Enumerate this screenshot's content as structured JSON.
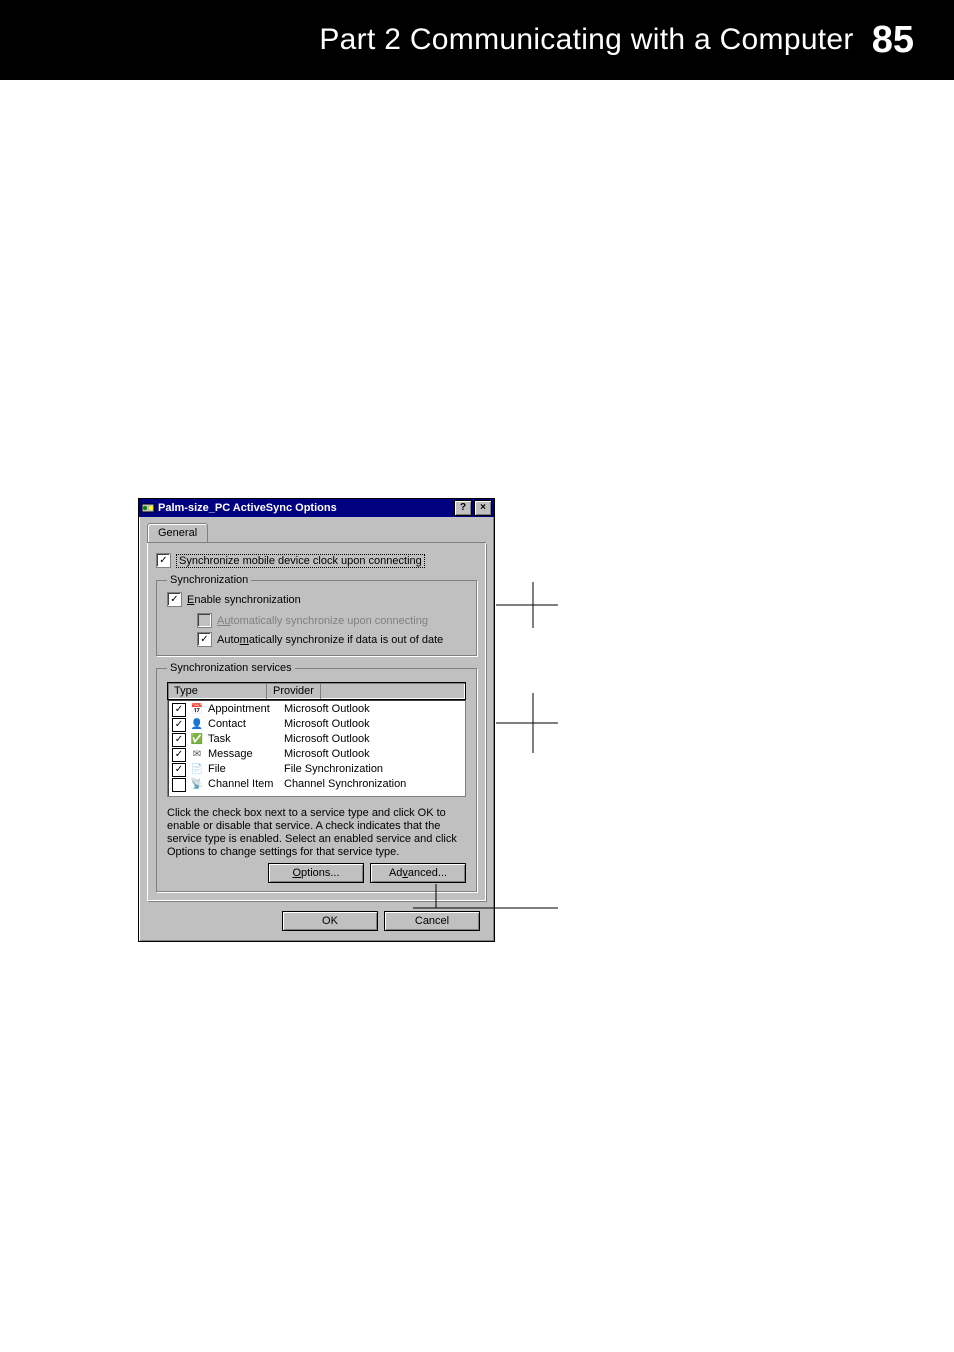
{
  "header": {
    "title": "Part 2  Communicating with a Computer",
    "page_number": "85"
  },
  "dialog": {
    "title": "Palm-size_PC ActiveSync Options",
    "titlebar": {
      "help": "?",
      "close": "×"
    },
    "tab": "General",
    "sync_clock_label": "Synchronize mobile device clock upon connecting",
    "group_sync": {
      "legend": "Synchronization",
      "enable_label_pre": "E",
      "enable_label_rest": "nable synchronization",
      "auto_connect_pre": "Au",
      "auto_connect_rest": "tomatically synchronize upon connecting",
      "auto_outofdate_pre": "Auto",
      "auto_outofdate_mid": "m",
      "auto_outofdate_rest": "atically synchronize if data is out of date"
    },
    "group_services": {
      "legend": "Synchronization services",
      "col_type": "Type",
      "col_provider": "Provider",
      "rows": [
        {
          "checked": true,
          "icon": "📅",
          "type": "Appointment",
          "provider": "Microsoft Outlook"
        },
        {
          "checked": true,
          "icon": "👤",
          "type": "Contact",
          "provider": "Microsoft Outlook"
        },
        {
          "checked": true,
          "icon": "✅",
          "type": "Task",
          "provider": "Microsoft Outlook"
        },
        {
          "checked": true,
          "icon": "✉",
          "type": "Message",
          "provider": "Microsoft Outlook"
        },
        {
          "checked": true,
          "icon": "📄",
          "type": "File",
          "provider": "File Synchronization"
        },
        {
          "checked": false,
          "icon": "📡",
          "type": "Channel Item",
          "provider": "Channel Synchronization"
        }
      ],
      "hint": "Click the check box next to a service type and click OK to enable or disable that service.  A check indicates that the service type is enabled.  Select an enabled service and click Options to change settings for that service type."
    },
    "buttons": {
      "options_pre": "O",
      "options_rest": "ptions...",
      "advanced_pre": "Ad",
      "advanced_mid": "v",
      "advanced_rest": "anced...",
      "ok": "OK",
      "cancel": "Cancel"
    }
  }
}
